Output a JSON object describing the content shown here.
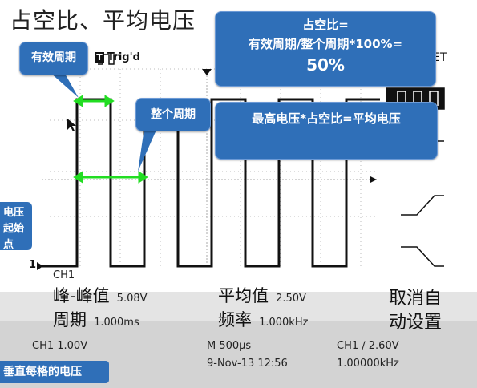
{
  "title": "占空比、平均电压",
  "header": {
    "trig_icon": "T",
    "trig_label": "Trig'd",
    "et_label": "ET"
  },
  "callouts": {
    "effective_period": "有效周期",
    "full_period": "整个周期",
    "duty_line1": "占空比=",
    "duty_line2": "有效周期/整个周期*100%=",
    "duty_value": "50%",
    "avg_formula": "最高电压*占空比=平均电压",
    "voltage_start_line1": "电压",
    "voltage_start_line2": "起始点",
    "vertical_grid_voltage": "垂直每格的电压"
  },
  "channel_marker": "1",
  "measurements": {
    "channel": "CH1",
    "pk2pk_label": "峰-峰值",
    "pk2pk_value": "5.08V",
    "period_label": "周期",
    "period_value": "1.000ms",
    "mean_label": "平均值",
    "mean_value": "2.50V",
    "freq_label": "频率",
    "freq_value": "1.000kHz"
  },
  "cancel_autoset": {
    "line1": "取消自",
    "line2": "动设置"
  },
  "status": {
    "ch1_volts": "CH1  1.00V",
    "timebase": "M 500µs",
    "date": "9-Nov-13 12:56",
    "trigger": "CH1 ∕ 2.60V",
    "trigger_freq": "1.00000kHz"
  },
  "colors": {
    "callout": "#2f6fb8",
    "arrow": "#22dd22",
    "trace": "#111111",
    "grid": "#bbbbbb"
  }
}
